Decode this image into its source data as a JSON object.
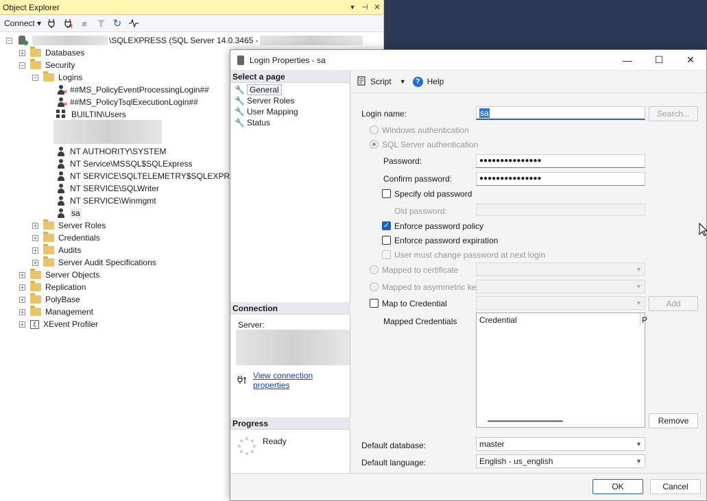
{
  "object_explorer": {
    "title": "Object Explorer",
    "controls": [
      "▾",
      "⊣",
      "✕"
    ],
    "connect_label": "Connect ▾",
    "server_label": "\\SQLEXPRESS (SQL Server 14.0.3465 -",
    "tree": {
      "databases": "Databases",
      "security": "Security",
      "logins": "Logins",
      "login_items": [
        "##MS_PolicyEventProcessingLogin##",
        "##MS_PolicyTsqlExecutionLogin##",
        "BUILTIN\\Users",
        "NT AUTHORITY\\SYSTEM",
        "NT Service\\MSSQL$SQLExpress",
        "NT SERVICE\\SQLTELEMETRY$SQLEXPRESS",
        "NT SERVICE\\SQLWriter",
        "NT SERVICE\\Winmgmt",
        "sa"
      ],
      "server_roles": "Server Roles",
      "credentials": "Credentials",
      "audits": "Audits",
      "server_audit_specs": "Server Audit Specifications",
      "server_objects": "Server Objects",
      "replication": "Replication",
      "polybase": "PolyBase",
      "management": "Management",
      "xevent_profiler": "XEvent Profiler"
    }
  },
  "dialog": {
    "title": "Login Properties - sa",
    "select_page_header": "Select a page",
    "pages": [
      "General",
      "Server Roles",
      "User Mapping",
      "Status"
    ],
    "connection_header": "Connection",
    "server_label": "Server:",
    "view_conn_link": "View connection properties",
    "progress_header": "Progress",
    "progress_status": "Ready",
    "toolbar": {
      "script": "Script",
      "help": "Help"
    },
    "form": {
      "login_name_label": "Login name:",
      "login_name_value": "sa",
      "search_button": "Search...",
      "windows_auth": "Windows authentication",
      "sql_auth": "SQL Server authentication",
      "password_label": "Password:",
      "password_value": "●●●●●●●●●●●●●●●",
      "confirm_label": "Confirm password:",
      "confirm_value": "●●●●●●●●●●●●●●●",
      "specify_old": "Specify old password",
      "old_password_label": "Old password:",
      "enforce_policy": "Enforce password policy",
      "enforce_expiration": "Enforce password expiration",
      "must_change": "User must change password at next login",
      "mapped_cert": "Mapped to certificate",
      "mapped_asym": "Mapped to asymmetric key",
      "map_credential": "Map to Credential",
      "add_button": "Add",
      "mapped_credentials_label": "Mapped Credentials",
      "grid_col_credential": "Credential",
      "grid_col_provider": "P",
      "remove_button": "Remove",
      "default_db_label": "Default database:",
      "default_db_value": "master",
      "default_lang_label": "Default language:",
      "default_lang_value": "English - us_english"
    },
    "buttons": {
      "ok": "OK",
      "cancel": "Cancel"
    }
  }
}
